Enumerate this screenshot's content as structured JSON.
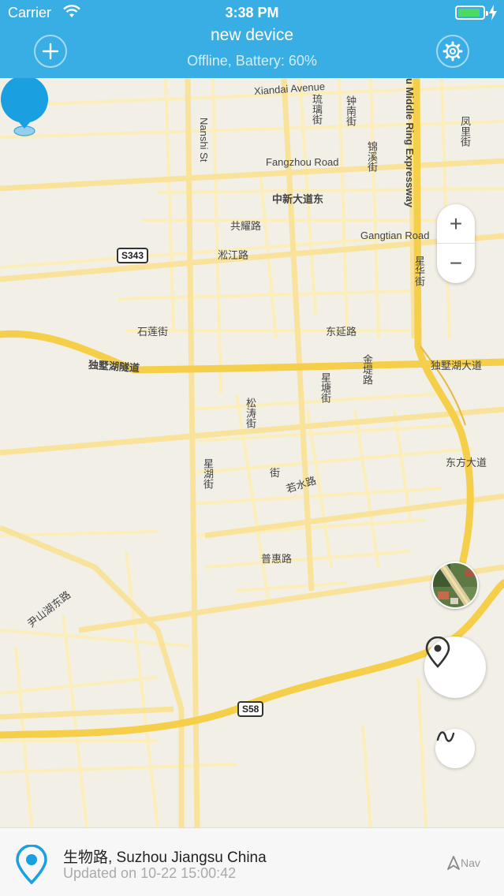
{
  "status_bar": {
    "carrier": "Carrier",
    "time": "3:38 PM",
    "battery_level": 0.9
  },
  "header": {
    "title": "new device",
    "subtitle": "Offline, Battery: 60%",
    "add_icon": "plus-icon",
    "settings_icon": "gear-icon"
  },
  "map": {
    "labels": {
      "xiandai_avenue": "Xiandai Avenue",
      "nanshi_st": "Nanshi St",
      "liuli_jie": "琉璃街",
      "zhongnan_jie": "钟南街",
      "middle_ring": "u Middle Ring Expressway",
      "fengli_jie": "凤里街",
      "jinxi_jie": "锦溪街",
      "fangzhou_road": "Fangzhou Road",
      "zhongxin_dadao": "中新大道东",
      "gongyao_lu": "共耀路",
      "gangtian_road": "Gangtian Road",
      "songjiang_lu": "淞江路",
      "xinghua_jie": "星华街",
      "shilian_jie": "石莲街",
      "dongyan_lu": "东延路",
      "dushuhu_tunnel": "独墅湖隧道",
      "jinti_lu": "金堤路",
      "dushuhu_dadao": "独墅湖大道",
      "xingtang_jie": "星塘街",
      "songtao_jie": "松涛街",
      "jie": "街",
      "xinghu_jie": "星湖街",
      "ruoshui_lu": "若水路",
      "dongfang_dadao": "东方大道",
      "puhui_lu": "普惠路",
      "yinshanhu_dong_lu": "尹山湖东路"
    },
    "shields": {
      "s343": "S343",
      "s58": "S58"
    },
    "zoom_in": "+",
    "zoom_out": "−"
  },
  "bottom": {
    "address": "生物路, Suzhou Jiangsu China",
    "updated": "Updated on 10-22 15:00:42",
    "nav_label": "Nav"
  },
  "colors": {
    "header": "#39aee5",
    "marker": "#1a9fe0",
    "major_road": "#f6cf4a",
    "minor_road": "#fdf3c7"
  }
}
